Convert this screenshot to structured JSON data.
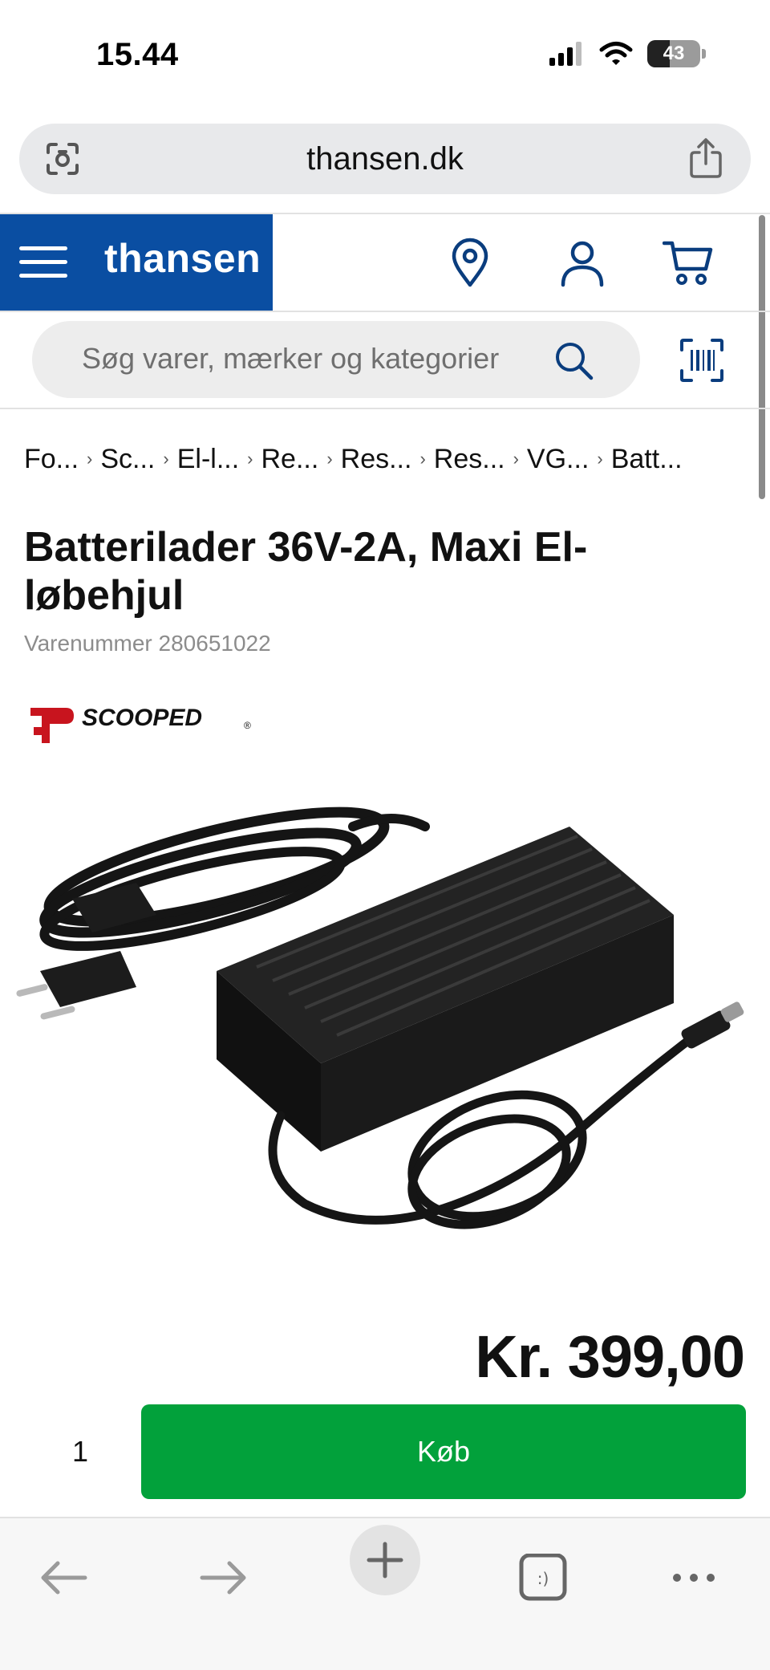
{
  "status_bar": {
    "time": "15.44",
    "battery_percent": "43",
    "battery_level": 0.43
  },
  "browser": {
    "url": "thansen.dk"
  },
  "site": {
    "brand": "thansen",
    "brand_color": "#0a4ea2",
    "accent_color": "#02a13b",
    "search_placeholder": "Søg varer, mærker og kategorier"
  },
  "breadcrumb": [
    "Fo...",
    "Sc...",
    "El-l...",
    "Re...",
    "Res...",
    "Res...",
    "VG...",
    "Batt..."
  ],
  "product": {
    "title": "Batterilader 36V-2A, Maxi El-løbehjul",
    "sku": "Varenummer 280651022",
    "brand_logo_text": "SCOOPED",
    "brand_logo_mark": "®",
    "price": "Kr. 399,00",
    "quantity": "1",
    "buy_label": "Køb"
  },
  "icons": {
    "url_left": "camera-scan-icon",
    "url_right": "share-icon",
    "menu": "hamburger-menu-icon",
    "location": "location-pin-icon",
    "account": "user-icon",
    "cart": "cart-icon",
    "search": "search-icon",
    "barcode": "barcode-scan-icon",
    "toolbar": [
      "back-arrow-icon",
      "forward-arrow-icon",
      "plus-icon",
      "tabs-icon",
      "more-icon"
    ]
  }
}
